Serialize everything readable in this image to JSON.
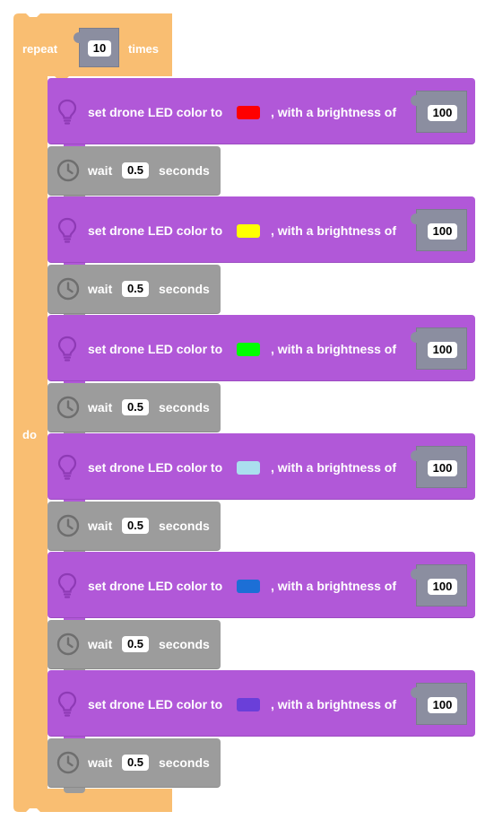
{
  "repeat": {
    "prefix": "repeat",
    "count": "10",
    "suffix": "times",
    "do_label": "do",
    "color": "#f9be72"
  },
  "led_block": {
    "label_prefix": "set drone LED color to",
    "label_suffix": ", with a brightness of",
    "color": "#b158d8",
    "icon": "lightbulb-icon"
  },
  "wait_block": {
    "label_prefix": "wait",
    "label_suffix": "seconds",
    "color": "#9c9c9c",
    "icon": "clock-icon"
  },
  "steps": [
    {
      "led_color": "#ff0000",
      "brightness": "100",
      "wait": "0.5"
    },
    {
      "led_color": "#ffff00",
      "brightness": "100",
      "wait": "0.5"
    },
    {
      "led_color": "#00ff00",
      "brightness": "100",
      "wait": "0.5"
    },
    {
      "led_color": "#aadfee",
      "brightness": "100",
      "wait": "0.5"
    },
    {
      "led_color": "#1c6fd6",
      "brightness": "100",
      "wait": "0.5"
    },
    {
      "led_color": "#6a3fd9",
      "brightness": "100",
      "wait": "0.5"
    }
  ]
}
